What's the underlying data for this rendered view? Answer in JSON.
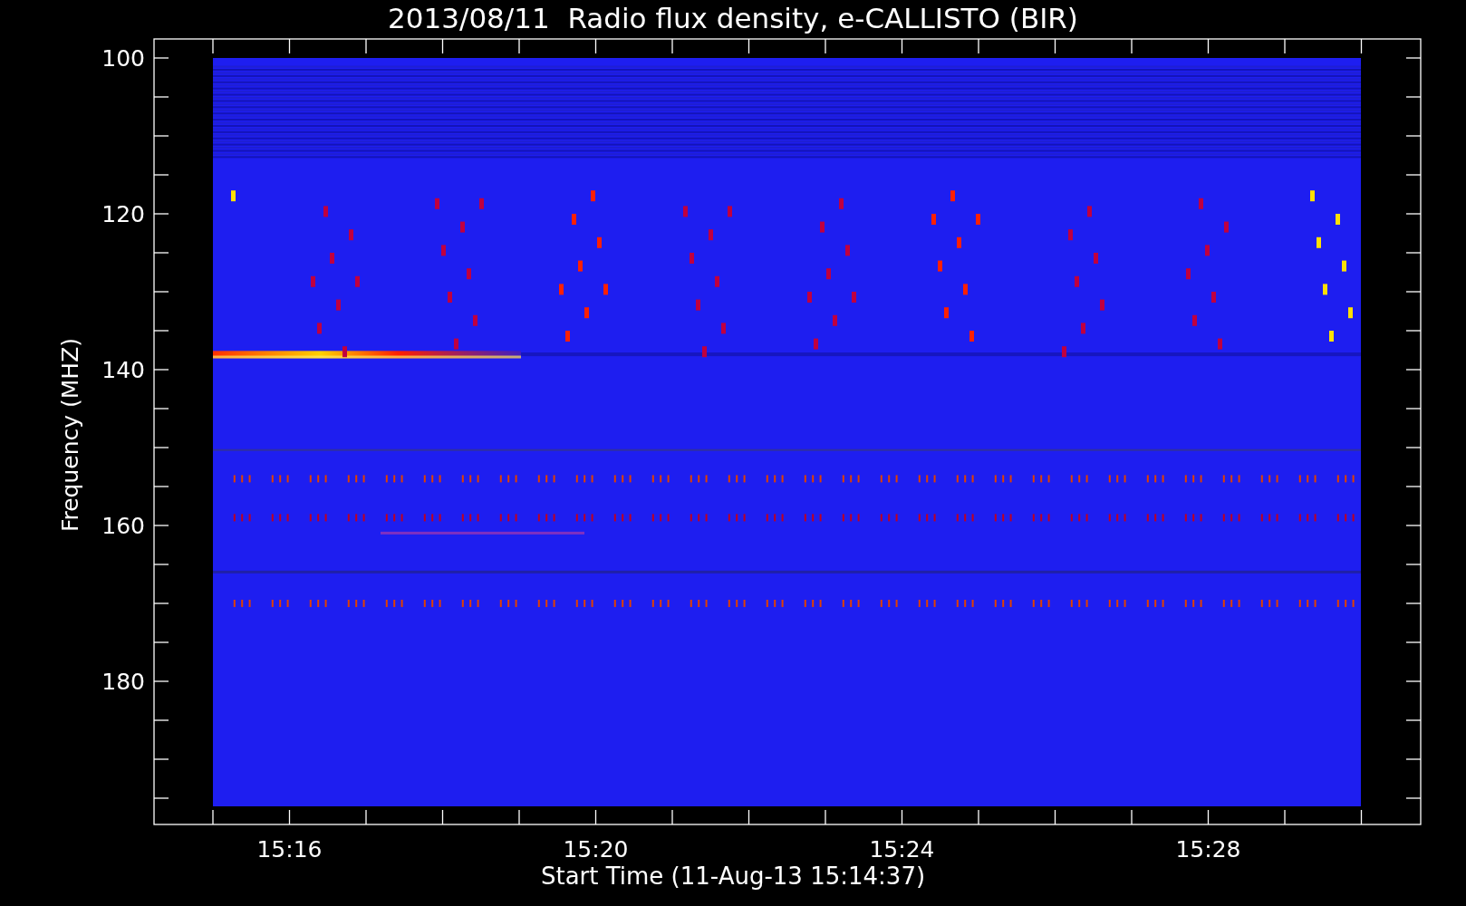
{
  "plot": {
    "title": "2013/08/11  Radio flux density, e-CALLISTO (BIR)",
    "ylabel": "Frequency (MHZ)",
    "xlabel": "Start Time (11-Aug-13 15:14:37)",
    "yticks": [
      "100",
      "120",
      "140",
      "160",
      "180"
    ],
    "xticks": [
      "15:16",
      "15:20",
      "15:24",
      "15:28"
    ]
  }
}
